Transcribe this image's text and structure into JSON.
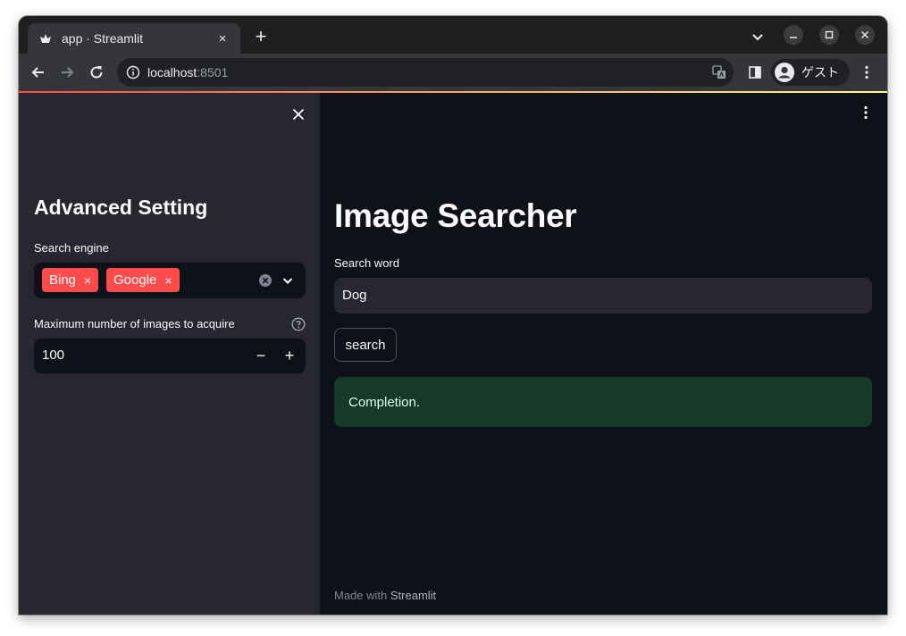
{
  "browser": {
    "tab_title": "app · Streamlit",
    "tab_close": "×",
    "new_tab": "+",
    "url_host": "localhost",
    "url_port": ":8501",
    "profile_label": "ゲスト"
  },
  "sidebar": {
    "close_icon": "close-icon",
    "title": "Advanced Setting",
    "engine_label": "Search engine",
    "selected_engines": [
      "Bing",
      "Google"
    ],
    "chip_remove": "×",
    "max_images_label": "Maximum number of images to acquire",
    "max_images_value": "100",
    "decrement": "−",
    "increment": "+"
  },
  "main": {
    "title": "Image Searcher",
    "search_label": "Search word",
    "search_value": "Dog",
    "search_button": "search",
    "alert_text": "Completion.",
    "footer_prefix": "Made with ",
    "footer_brand": "Streamlit"
  },
  "colors": {
    "accent": "#ff4b4b",
    "sidebar_bg": "#262730",
    "main_bg": "#0e1117",
    "success_bg": "#173928",
    "success_text": "#dffde9"
  }
}
